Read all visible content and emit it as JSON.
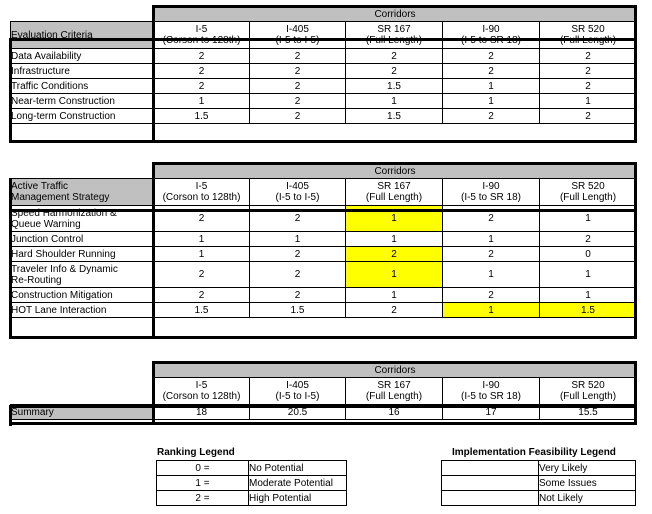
{
  "corridors": {
    "banner": "Corridors",
    "columns": [
      {
        "name": "I-5",
        "extent": "(Corson to 128th)"
      },
      {
        "name": "I-405",
        "extent": "(I-5 to I-5)"
      },
      {
        "name": "SR 167",
        "extent": "(Full Length)"
      },
      {
        "name": "I-90",
        "extent": "(I-5 to SR 18)"
      },
      {
        "name": "SR 520",
        "extent": "(Full Length)"
      }
    ]
  },
  "table_evaluation": {
    "row_header": "Evaluation Criteria",
    "rows": [
      {
        "label": "Data Availability",
        "values": [
          "2",
          "2",
          "2",
          "2",
          "2"
        ]
      },
      {
        "label": "Infrastructure",
        "values": [
          "2",
          "2",
          "2",
          "2",
          "2"
        ]
      },
      {
        "label": "Traffic Conditions",
        "values": [
          "2",
          "2",
          "1.5",
          "1",
          "2"
        ]
      },
      {
        "label": "Near-term Construction",
        "values": [
          "1",
          "2",
          "1",
          "1",
          "1"
        ]
      },
      {
        "label": "Long-term Construction",
        "values": [
          "1.5",
          "2",
          "1.5",
          "2",
          "2"
        ]
      }
    ]
  },
  "table_strategy": {
    "row_header_line1": "Active Traffic",
    "row_header_line2": "Management Strategy",
    "rows": [
      {
        "label_line1": "Speed Harmonization &",
        "label_line2": "Queue Warning",
        "values": [
          "2",
          "2",
          "1",
          "2",
          "1"
        ],
        "highlight": [
          false,
          false,
          true,
          false,
          false
        ]
      },
      {
        "label_line1": "Junction Control",
        "label_line2": "",
        "values": [
          "1",
          "1",
          "1",
          "1",
          "2"
        ],
        "highlight": [
          false,
          false,
          false,
          false,
          false
        ]
      },
      {
        "label_line1": "Hard Shoulder Running",
        "label_line2": "",
        "values": [
          "1",
          "2",
          "2",
          "2",
          "0"
        ],
        "highlight": [
          false,
          false,
          true,
          false,
          false
        ]
      },
      {
        "label_line1": "Traveler Info & Dynamic",
        "label_line2": "Re-Routing",
        "values": [
          "2",
          "2",
          "1",
          "1",
          "1"
        ],
        "highlight": [
          false,
          false,
          true,
          false,
          false
        ]
      },
      {
        "label_line1": "Construction Mitigation",
        "label_line2": "",
        "values": [
          "2",
          "2",
          "1",
          "2",
          "1"
        ],
        "highlight": [
          false,
          false,
          false,
          false,
          false
        ]
      },
      {
        "label_line1": "HOT Lane Interaction",
        "label_line2": "",
        "values": [
          "1.5",
          "1.5",
          "2",
          "1",
          "1.5"
        ],
        "highlight": [
          false,
          false,
          false,
          true,
          true
        ]
      }
    ]
  },
  "table_summary": {
    "label": "Summary",
    "values": [
      "18",
      "20.5",
      "16",
      "17",
      "15.5"
    ]
  },
  "ranking_legend": {
    "title": "Ranking Legend",
    "rows": [
      {
        "key": "0 =",
        "value": "No Potential"
      },
      {
        "key": "1 =",
        "value": "Moderate Potential"
      },
      {
        "key": "2 =",
        "value": "High Potential"
      }
    ]
  },
  "feasibility_legend": {
    "title": "Implementation Feasibility Legend",
    "rows": [
      {
        "color": "#ffffff",
        "swatch": "white-swatch",
        "value": "Very Likely"
      },
      {
        "color": "#ffff00",
        "swatch": "yellow-swatch",
        "value": "Some Issues"
      },
      {
        "color": "#ff0000",
        "swatch": "red-swatch",
        "value": "Not Likely"
      }
    ]
  },
  "colors": {
    "header_gray": "#c0c0c0",
    "highlight_yellow": "#ffff00",
    "not_likely_red": "#ff0000",
    "border_black": "#000000",
    "background_white": "#ffffff"
  }
}
